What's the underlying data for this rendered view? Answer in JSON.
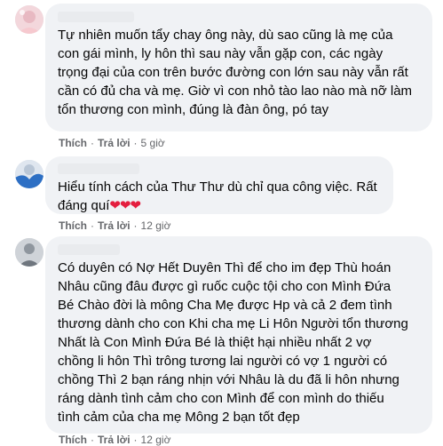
{
  "comments": [
    {
      "author": "",
      "text": "Tự nhiên muốn tẩy chay ông này, dù sao cũng là mẹ của con gái mình, ly hôn thì sau này vẫn gặp con, các ngày trọng đại của con trên bước đường con lớn sau này vẫn rất cần có đủ cha và mẹ. Giờ vì con nhỏ tào lao nào mà nỡ làm tổn thương con mình, đúng là đàn ông, pó tay",
      "like": "Thích",
      "reply": "Trả lời",
      "time": "5 giờ"
    },
    {
      "author": "",
      "text": "Hiểu tính cách của Thư Thư dù chỉ qua công việc. Rất đáng quí",
      "emoji": "❤❤❤",
      "like": "Thích",
      "reply": "Trả lời",
      "time": "12 giờ"
    },
    {
      "author": "",
      "text": "Có duyên có Nợ Hết Duyên Thì để cho im đẹp Thù hoán Nhâu cũng đâu được gì ruốc cuộc tội cho con Mình Đứa Bé Chào đời là mông Cha Mẹ được Hp và cả 2 đem tình thương dành cho con Khi cha mẹ Li Hôn Người tổn thương Nhất là Con Mình Đứa Bé là thiệt hại nhiều nhất 2 vợ chồng li hôn Thì trông tương lai người có vợ 1 người có chồng Thì 2 bạn ráng nhịn với Nhâu là du đã li hôn nhưng ráng dành tình cảm cho con Mình để con mình do thiếu tình cảm của cha mẹ Mông 2 bạn tốt đẹp",
      "like": "Thích",
      "reply": "Trả lời",
      "time": "12 giờ"
    }
  ]
}
